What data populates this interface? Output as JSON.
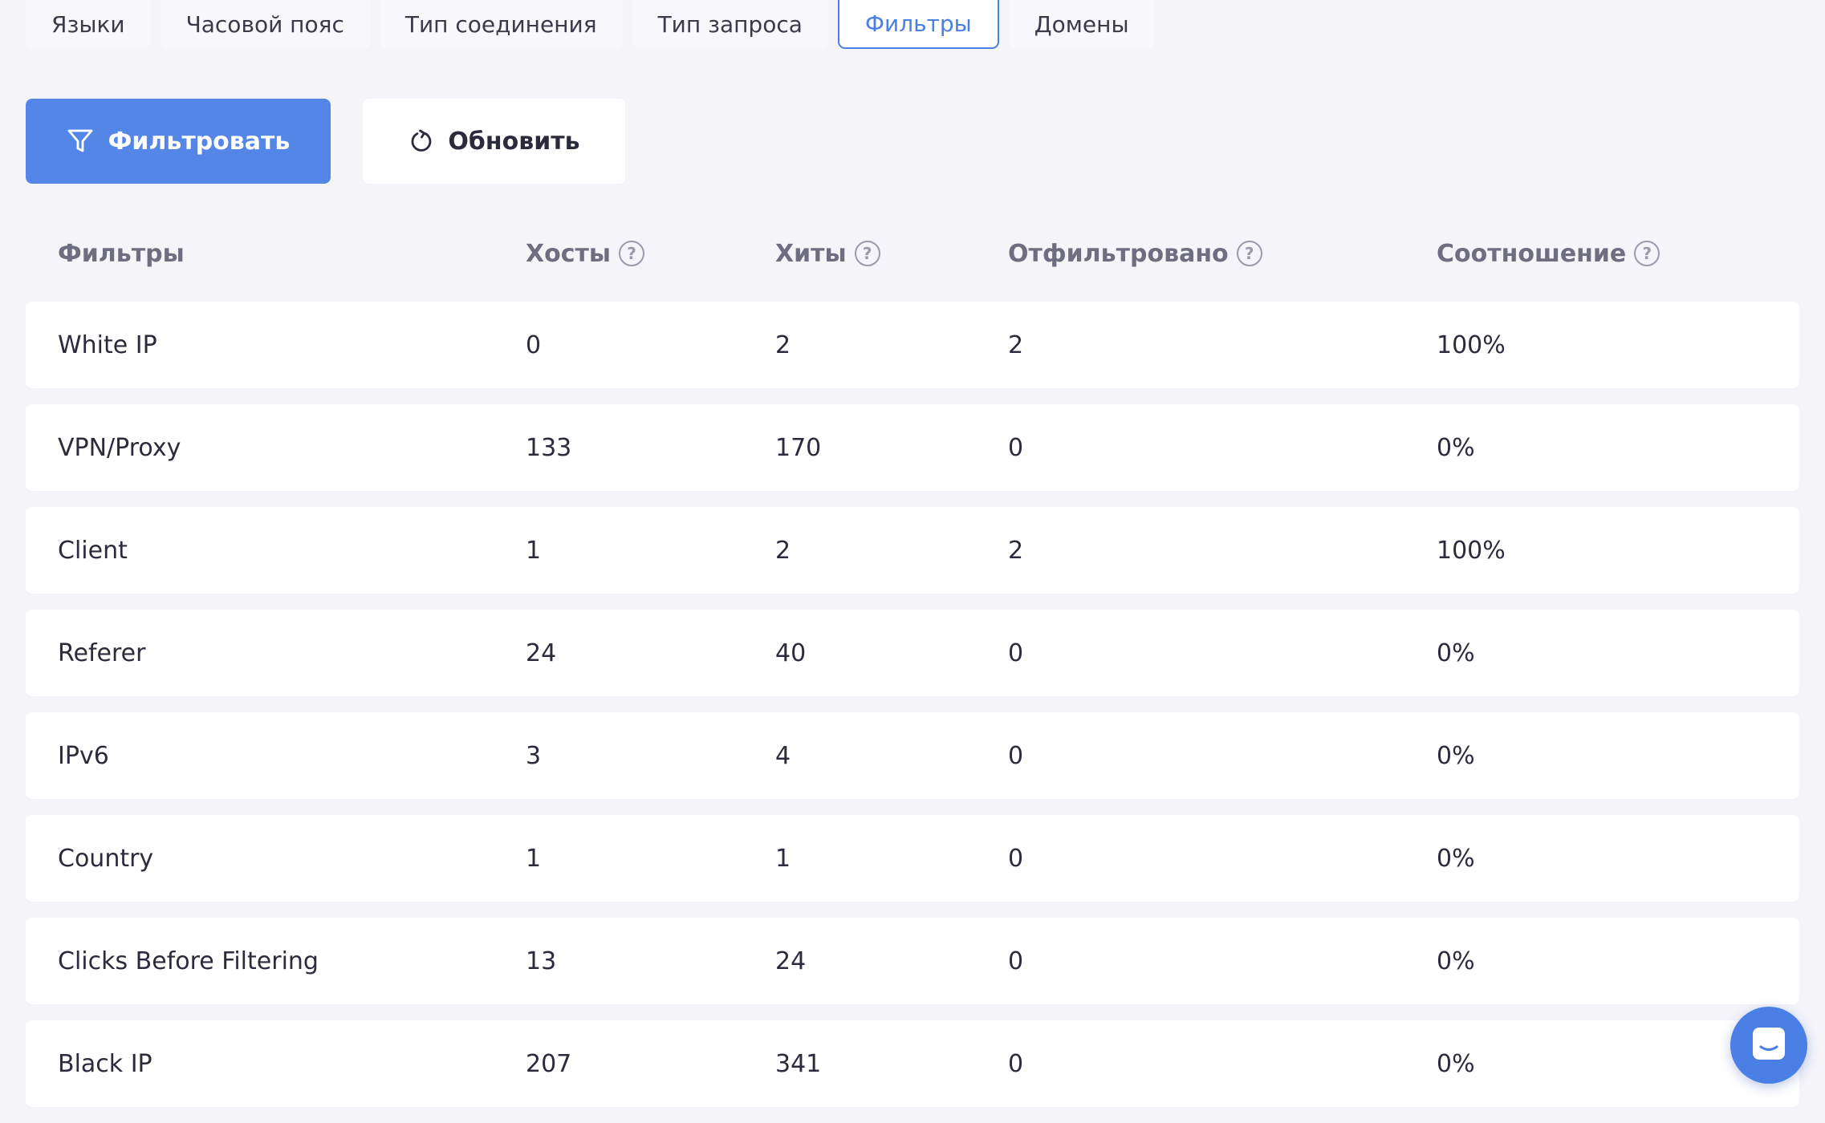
{
  "tabs": [
    {
      "label": "Языки",
      "active": false
    },
    {
      "label": "Часовой пояс",
      "active": false
    },
    {
      "label": "Тип соединения",
      "active": false
    },
    {
      "label": "Тип запроса",
      "active": false
    },
    {
      "label": "Фильтры",
      "active": true
    },
    {
      "label": "Домены",
      "active": false
    }
  ],
  "toolbar": {
    "filter_label": "Фильтровать",
    "filter_icon": "funnel-icon",
    "refresh_label": "Обновить",
    "refresh_icon": "refresh-icon"
  },
  "table": {
    "columns": [
      {
        "label": "Фильтры",
        "help": false
      },
      {
        "label": "Хосты",
        "help": true
      },
      {
        "label": "Хиты",
        "help": true
      },
      {
        "label": "Отфильтровано",
        "help": true
      },
      {
        "label": "Соотношение",
        "help": true
      }
    ],
    "help_glyph": "?",
    "rows": [
      [
        "White IP",
        "0",
        "2",
        "2",
        "100%"
      ],
      [
        "VPN/Proxy",
        "133",
        "170",
        "0",
        "0%"
      ],
      [
        "Client",
        "1",
        "2",
        "2",
        "100%"
      ],
      [
        "Referer",
        "24",
        "40",
        "0",
        "0%"
      ],
      [
        "IPv6",
        "3",
        "4",
        "0",
        "0%"
      ],
      [
        "Country",
        "1",
        "1",
        "0",
        "0%"
      ],
      [
        "Clicks Before Filtering",
        "13",
        "24",
        "0",
        "0%"
      ],
      [
        "Black IP",
        "207",
        "341",
        "0",
        "0%"
      ]
    ]
  },
  "colors": {
    "accent": "#4a7fe6",
    "primary_button": "#5486e8",
    "background": "#f4f4f9",
    "header_text": "#6e6e80"
  },
  "chat": {
    "icon": "chat-icon"
  }
}
